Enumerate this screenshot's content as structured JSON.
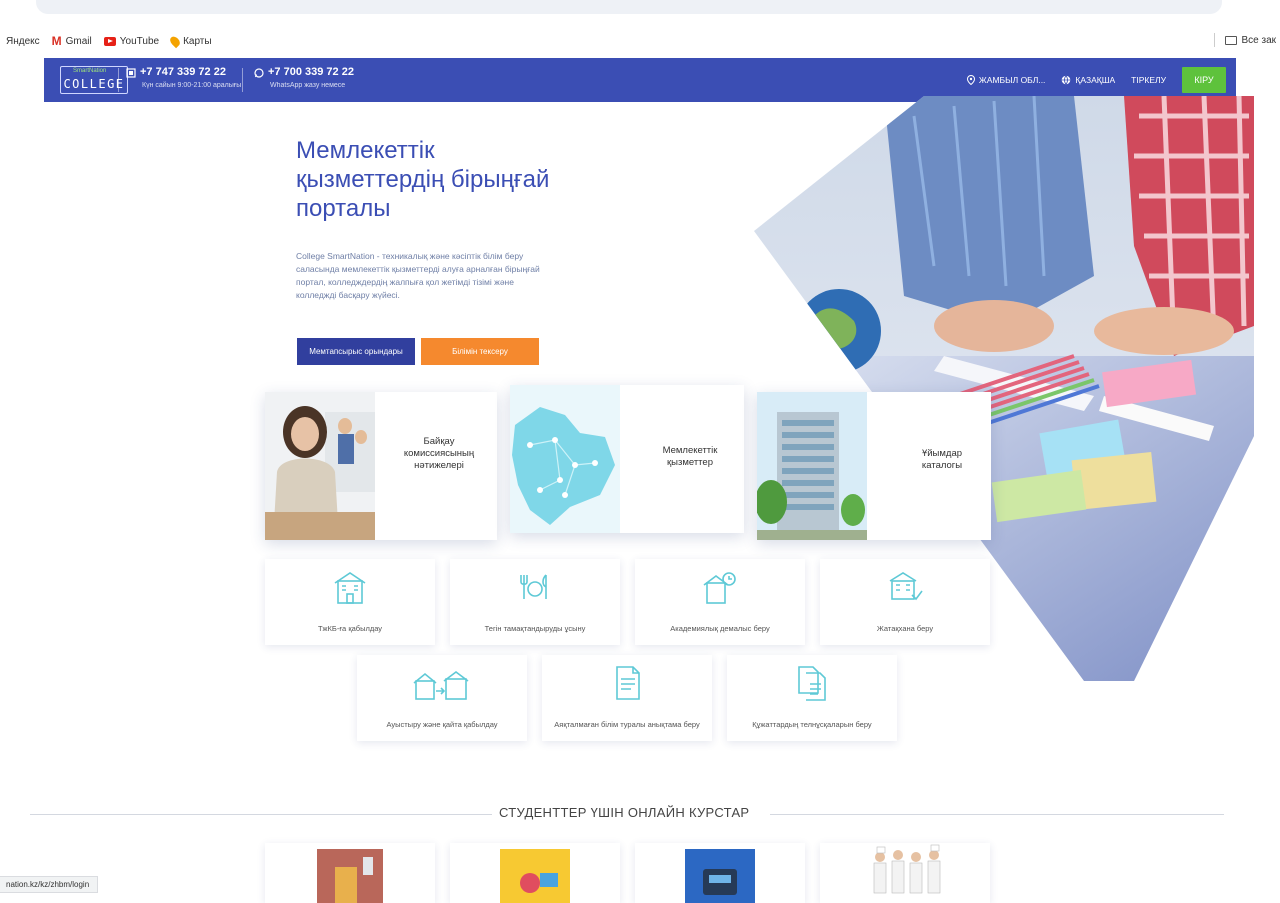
{
  "bookmarks": {
    "items": [
      {
        "label": "Яндекс"
      },
      {
        "label": "Gmail"
      },
      {
        "label": "YouTube"
      },
      {
        "label": "Карты"
      }
    ],
    "all_bookmarks": "Все зак"
  },
  "navbar": {
    "logo": {
      "top_text": "SmartNation",
      "main_text": "COLLEGE"
    },
    "phone1": {
      "number": "+7 747 339 72 22",
      "note": "Күн сайын 9:00-21:00 аралығы"
    },
    "phone2": {
      "number": "+7 700 339 72 22",
      "note": "WhatsApp жазу немесе"
    },
    "region": "ЖАМБЫЛ ОБЛ...",
    "language": "ҚАЗАҚША",
    "register": "ТІРКЕЛУ",
    "login": "КІРУ"
  },
  "hero": {
    "title": "Мемлекеттік қызметтердің бірыңғай порталы",
    "description": "College SmartNation - техникалық және кәсіптік білім беру саласында мемлекеттік қызметтерді алуға арналған бірыңғай портал, колледждердің жалпыға қол жетімді тізімі және колледжді басқару жүйесі.",
    "btn_results": "Мемтапсырыс орындары",
    "btn_check": "Білімін тексеру"
  },
  "big_cards": [
    {
      "label": "Байқау комиссиясының нәтижелері"
    },
    {
      "label": "Мемлекеттік қызметтер"
    },
    {
      "label": "Ұйымдар каталогы"
    }
  ],
  "services": [
    {
      "label": "ТжКБ-ға қабылдау",
      "icon": "school-building-icon"
    },
    {
      "label": "Тегін тамақтандыруды ұсыну",
      "icon": "cutlery-icon"
    },
    {
      "label": "Академиялық демалыс беру",
      "icon": "academic-leave-icon"
    },
    {
      "label": "Жатақхана беру",
      "icon": "dormitory-icon"
    },
    {
      "label": "Ауыстыру және қайта қабылдау",
      "icon": "transfer-icon"
    },
    {
      "label": "Аяқталмаған білім туралы анықтама беру",
      "icon": "certificate-icon"
    },
    {
      "label": "Құжаттардың телнұсқаларын беру",
      "icon": "duplicate-documents-icon"
    }
  ],
  "courses": {
    "title": "СТУДЕНТТЕР ҮШІН ОНЛАЙН КУРСТАР"
  },
  "status_bar": {
    "url": "nation.kz/kz/zhbm/login"
  },
  "colors": {
    "brand_blue": "#3b4eb4",
    "accent_orange": "#f5892e",
    "login_green": "#5ec23c",
    "icon_teal": "#5ec9d6"
  }
}
